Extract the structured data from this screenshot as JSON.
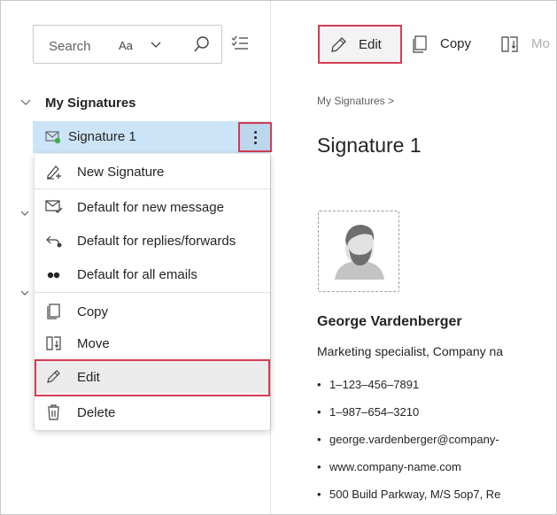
{
  "search": {
    "placeholder": "Search",
    "match_case": "Aa"
  },
  "tree": {
    "root_label": "My Signatures",
    "selected_item": "Signature 1"
  },
  "context_menu": {
    "items": [
      {
        "label": "New Signature",
        "icon": "new-signature-icon"
      },
      {
        "label": "Default for new message",
        "icon": "mail-check-icon"
      },
      {
        "label": "Default for replies/forwards",
        "icon": "reply-icon"
      },
      {
        "label": "Default for all emails",
        "icon": "two-dots-icon"
      },
      {
        "label": "Copy",
        "icon": "copy-icon"
      },
      {
        "label": "Move",
        "icon": "move-icon"
      },
      {
        "label": "Edit",
        "icon": "pencil-icon"
      },
      {
        "label": "Delete",
        "icon": "trash-icon"
      }
    ]
  },
  "toolbar": {
    "edit_label": "Edit",
    "copy_label": "Copy",
    "move_label": "Mo"
  },
  "detail": {
    "breadcrumb": "My Signatures >",
    "title": "Signature 1",
    "person_name": "George Vardenberger",
    "role": "Marketing specialist, Company na",
    "contacts": [
      "1–123–456–7891",
      "1–987–654–3210",
      "george.vardenberger@company-",
      "www.company-name.com",
      "500 Build Parkway, M/S 5op7, Re"
    ]
  },
  "colors": {
    "selection": "#cce4f7",
    "highlight_border": "#d23c56",
    "status_green": "#3fae49"
  }
}
